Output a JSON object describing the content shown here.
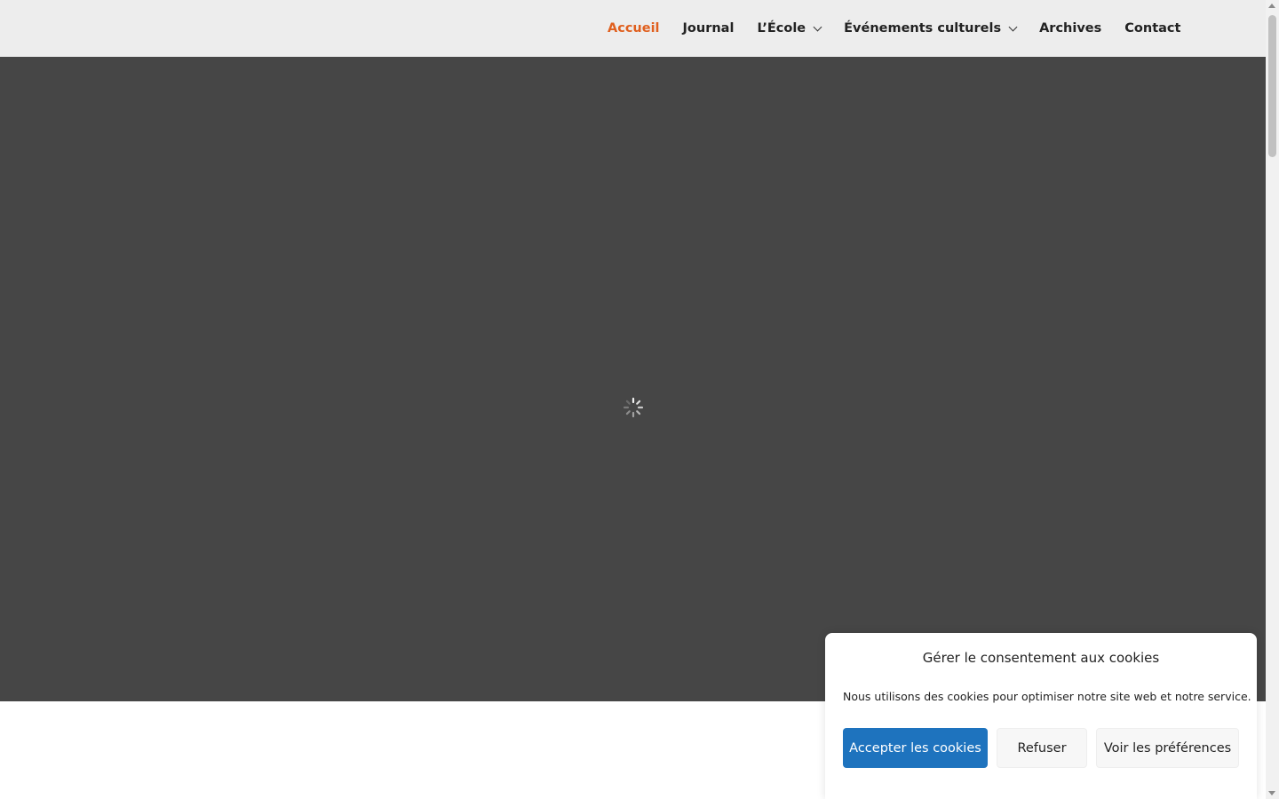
{
  "nav": {
    "items": [
      {
        "label": "Accueil",
        "active": true,
        "has_dropdown": false
      },
      {
        "label": "Journal",
        "active": false,
        "has_dropdown": false
      },
      {
        "label": "L’École",
        "active": false,
        "has_dropdown": true
      },
      {
        "label": "Événements culturels",
        "active": false,
        "has_dropdown": true
      },
      {
        "label": "Archives",
        "active": false,
        "has_dropdown": false
      },
      {
        "label": "Contact",
        "active": false,
        "has_dropdown": false
      }
    ]
  },
  "hero": {
    "loading_icon": "spinner-icon",
    "background": "#464646"
  },
  "cookie_banner": {
    "title": "Gérer le consentement aux cookies",
    "message": "Nous utilisons des cookies pour optimiser notre site web et notre service.",
    "accept_label": "Accepter les cookies",
    "refuse_label": "Refuser",
    "preferences_label": "Voir les préférences"
  },
  "colors": {
    "accent": "#e0601f",
    "primary_button": "#1e73be",
    "header_bg": "#ededed"
  }
}
